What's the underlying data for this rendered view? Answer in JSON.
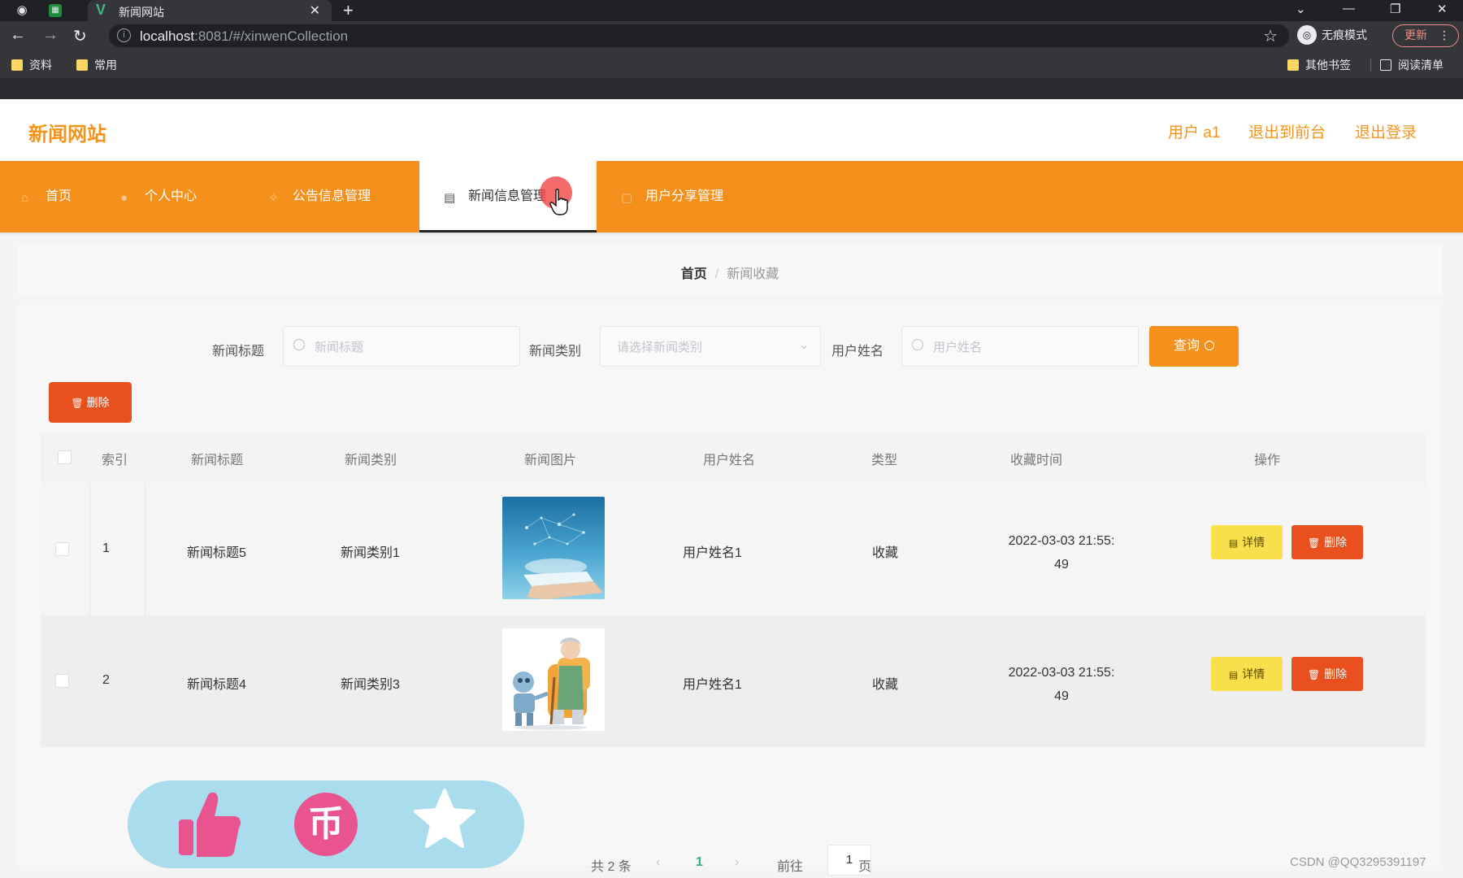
{
  "browser": {
    "tab_title": "新闻网站",
    "url_host": "localhost",
    "url_path": ":8081/#/xinwenCollection",
    "incognito_label": "无痕模式",
    "update_label": "更新",
    "bookmarks": [
      "资料",
      "常用"
    ],
    "other_bookmarks": "其他书签",
    "reading_list": "阅读清单"
  },
  "site": {
    "logo": "新闻网站",
    "user_label": "用户 a1",
    "to_front_label": "退出到前台",
    "logout_label": "退出登录"
  },
  "nav": {
    "items": [
      {
        "label": "首页",
        "icon": "home-icon"
      },
      {
        "label": "个人中心",
        "icon": "user-icon"
      },
      {
        "label": "公告信息管理",
        "icon": "notice-icon"
      },
      {
        "label": "新闻信息管理",
        "icon": "news-icon",
        "active": true
      },
      {
        "label": "用户分享管理",
        "icon": "share-icon"
      }
    ]
  },
  "breadcrumb": {
    "home": "首页",
    "separator": "/",
    "current": "新闻收藏"
  },
  "filters": {
    "title_label": "新闻标题",
    "title_placeholder": "新闻标题",
    "category_label": "新闻类别",
    "category_placeholder": "请选择新闻类别",
    "username_label": "用户姓名",
    "username_placeholder": "用户姓名",
    "query_label": "查询"
  },
  "bulk_delete_label": "删除",
  "table": {
    "headers": [
      "索引",
      "新闻标题",
      "新闻类别",
      "新闻图片",
      "用户姓名",
      "类型",
      "收藏时间",
      "操作"
    ],
    "rows": [
      {
        "index": "1",
        "title": "新闻标题5",
        "category": "新闻类别1",
        "image": "news-image-tablet",
        "username": "用户姓名1",
        "type": "收藏",
        "time_line1": "2022-03-03 21:55:",
        "time_line2": "49"
      },
      {
        "index": "2",
        "title": "新闻标题4",
        "category": "新闻类别3",
        "image": "news-image-robot-elder",
        "username": "用户姓名1",
        "type": "收藏",
        "time_line1": "2022-03-03 21:55:",
        "time_line2": "49"
      }
    ],
    "detail_label": "详情",
    "delete_label": "删除"
  },
  "pagination": {
    "total": "共 2 条",
    "current_page": "1",
    "goto_label": "前往",
    "goto_value": "1",
    "page_suffix": "页"
  },
  "watermark": "CSDN @QQ3295391197",
  "colors": {
    "brand": "#f4901b",
    "danger": "#e8501e",
    "detail": "#f8e04c",
    "pager_active": "#2eb18a"
  }
}
